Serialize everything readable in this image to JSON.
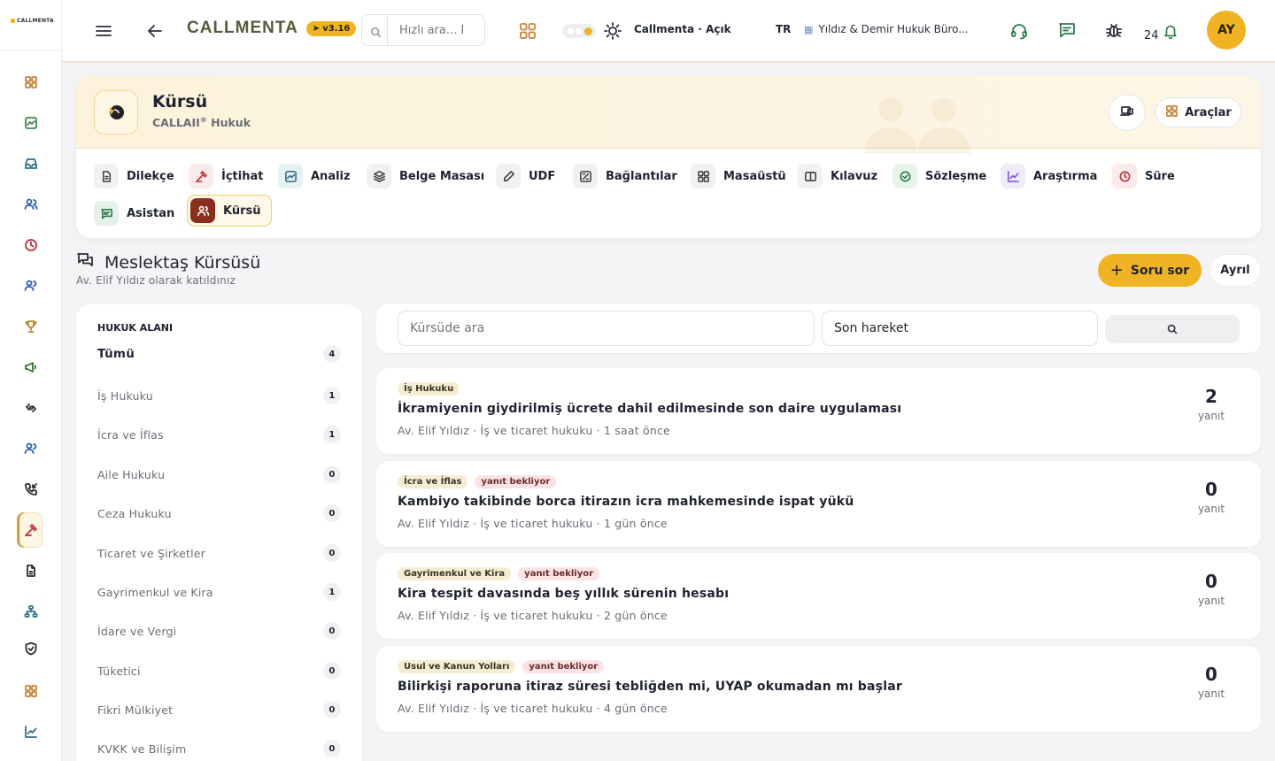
{
  "app": {
    "logo_text": "CALLMENTA"
  },
  "header": {
    "brand": "CALLMENTA",
    "version": "v3.16",
    "search_placeholder": "Hızlı ara... I",
    "theme_label": "Callmenta · Açık",
    "language": "TR",
    "firm": "Yıldız & Demir Hukuk Büro...",
    "notification_count": "24",
    "avatar_initials": "AY"
  },
  "page": {
    "title": "Kürsü",
    "subtitle_pre": "CALLAII",
    "subtitle_sup": "®",
    "subtitle_post": "Hukuk",
    "tools_label": "Araçlar"
  },
  "tabs": [
    {
      "label": "Dilekçe",
      "icon": "document-icon"
    },
    {
      "label": "İçtihat",
      "icon": "gavel-icon"
    },
    {
      "label": "Analiz",
      "icon": "analysis-icon"
    },
    {
      "label": "Belge Masası",
      "icon": "layers-icon"
    },
    {
      "label": "UDF",
      "icon": "pen-icon"
    },
    {
      "label": "Bağlantılar",
      "icon": "link-icon"
    },
    {
      "label": "Masaüstü",
      "icon": "grid-icon"
    },
    {
      "label": "Kılavuz",
      "icon": "book-icon"
    },
    {
      "label": "Sözleşme",
      "icon": "check-badge-icon"
    },
    {
      "label": "Araştırma",
      "icon": "chart-icon"
    },
    {
      "label": "Süre",
      "icon": "clock-icon"
    },
    {
      "label": "Asistan",
      "icon": "chat-icon"
    },
    {
      "label": "Kürsü",
      "icon": "users-icon"
    }
  ],
  "section": {
    "title": "Meslektaş Kürsüsü",
    "subtitle": "Av. Elif Yıldız olarak katıldınız",
    "ask_label": "Soru sor",
    "leave_label": "Ayrıl"
  },
  "filter": {
    "heading": "HUKUK ALANI",
    "items": [
      {
        "label": "Tümü",
        "count": "4"
      },
      {
        "label": "İş Hukuku",
        "count": "1"
      },
      {
        "label": "İcra ve İflas",
        "count": "1"
      },
      {
        "label": "Aile Hukuku",
        "count": "0"
      },
      {
        "label": "Ceza Hukuku",
        "count": "0"
      },
      {
        "label": "Ticaret ve Şirketler",
        "count": "0"
      },
      {
        "label": "Gayrimenkul ve Kira",
        "count": "1"
      },
      {
        "label": "İdare ve Vergi",
        "count": "0"
      },
      {
        "label": "Tüketici",
        "count": "0"
      },
      {
        "label": "Fikri Mülkiyet",
        "count": "0"
      },
      {
        "label": "KVKK ve Bilişim",
        "count": "0"
      }
    ]
  },
  "search": {
    "placeholder": "Kürsüde ara",
    "sort_value": "Son hareket"
  },
  "questions": [
    {
      "tag": "İş Hukuku",
      "status": "",
      "title": "İkramiyenin giydirilmiş ücrete dahil edilmesinde son daire uygulaması",
      "meta": "Av. Elif Yıldız · İş ve ticaret hukuku · 1 saat önce",
      "replies": "2",
      "replies_label": "yanıt"
    },
    {
      "tag": "İcra ve İflas",
      "status": "yanıt bekliyor",
      "title": "Kambiyo takibinde borca itirazın icra mahkemesinde ispat yükü",
      "meta": "Av. Elif Yıldız · İş ve ticaret hukuku · 1 gün önce",
      "replies": "0",
      "replies_label": "yanıt"
    },
    {
      "tag": "Gayrimenkul ve Kira",
      "status": "yanıt bekliyor",
      "title": "Kira tespit davasında beş yıllık sürenin hesabı",
      "meta": "Av. Elif Yıldız · İş ve ticaret hukuku · 2 gün önce",
      "replies": "0",
      "replies_label": "yanıt"
    },
    {
      "tag": "Usul ve Kanun Yolları",
      "status": "yanıt bekliyor",
      "title": "Bilirkişi raporuna itiraz süresi tebliğden mi, UYAP okumadan mı başlar",
      "meta": "Av. Elif Yıldız · İş ve ticaret hukuku · 4 gün önce",
      "replies": "0",
      "replies_label": "yanıt"
    }
  ],
  "colors": {
    "accent": "#f0b323",
    "active_tab": "#8a2e1e"
  }
}
